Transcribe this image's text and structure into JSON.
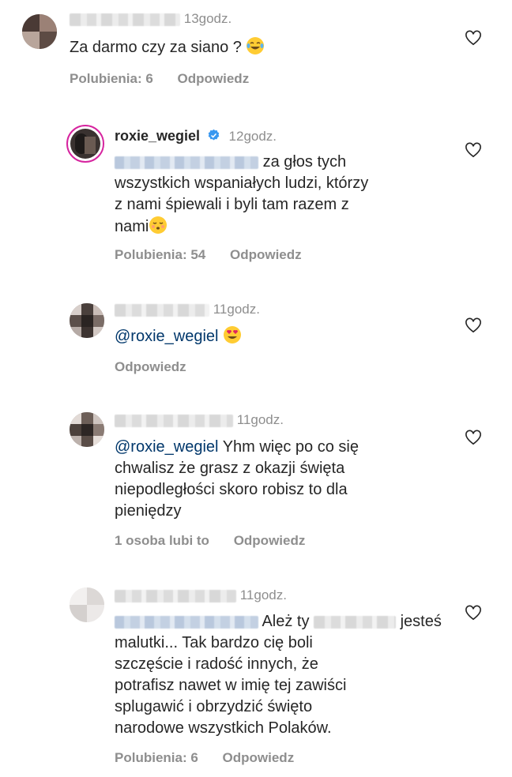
{
  "comments": [
    {
      "time": "13godz.",
      "text": "Za darmo czy za siano ?",
      "emoji": "tears-of-joy-emoji",
      "likes": "Polubienia: 6",
      "reply": "Odpowiedz"
    },
    {
      "username": "roxie_wegiel",
      "verified": true,
      "time": "12godz.",
      "text_line1": "za głos tych",
      "text_line2": "wszystkich wspaniałych ludzi, którzy",
      "text_line3": "z nami śpiewali i byli tam razem z",
      "text_line4": "nami",
      "emoji": "kissing-emoji",
      "likes": "Polubienia: 54",
      "reply": "Odpowiedz"
    },
    {
      "time": "11godz.",
      "mention": "@roxie_wegiel",
      "emoji": "heart-eyes-emoji",
      "reply": "Odpowiedz"
    },
    {
      "time": "11godz.",
      "mention": "@roxie_wegiel",
      "text_line1": "Yhm więc po co się",
      "text_line2": "chwalisz że grasz z okazji święta",
      "text_line3": "niepodległości skoro robisz to dla",
      "text_line4": "pieniędzy",
      "likes": "1 osoba lubi to",
      "reply": "Odpowiedz"
    },
    {
      "time": "11godz.",
      "text_a": "Ależ ty",
      "text_b": "jesteś",
      "text_line2": "malutki... Tak bardzo cię boli",
      "text_line3": "szczęście i radość innych, że",
      "text_line4": "potrafisz nawet w imię tej zawiści",
      "text_line5": "splugawić i obrzydzić święto",
      "text_line6": "narodowe wszystkich Polaków.",
      "likes": "Polubienia: 6",
      "reply": "Odpowiedz"
    }
  ],
  "colors": {
    "text": "#262626",
    "muted": "#8e8e8e",
    "mention": "#00376b",
    "verified": "#3897f0",
    "ring": "#d6249f"
  }
}
